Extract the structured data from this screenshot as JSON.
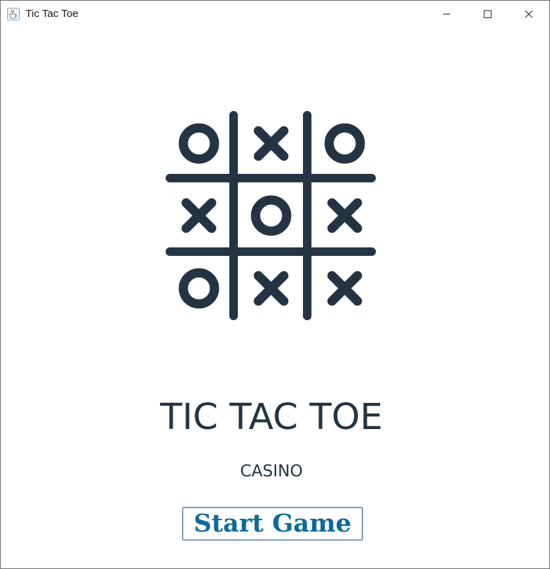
{
  "window": {
    "title": "Tic Tac Toe",
    "icon": "java-cup-icon",
    "controls": [
      "minimize-icon",
      "maximize-icon",
      "close-icon"
    ]
  },
  "logo": {
    "icon": "tic-tac-toe-board-icon",
    "board": [
      [
        "O",
        "X",
        "O"
      ],
      [
        "X",
        "O",
        "X"
      ],
      [
        "O",
        "X",
        "X"
      ]
    ],
    "color": "#243442"
  },
  "main": {
    "title": "TIC TAC TOE",
    "subtitle": "CASINO",
    "start_label": "Start Game"
  },
  "colors": {
    "text": "#243442",
    "button_text": "#0d6a99",
    "button_border": "#7f9db9"
  }
}
